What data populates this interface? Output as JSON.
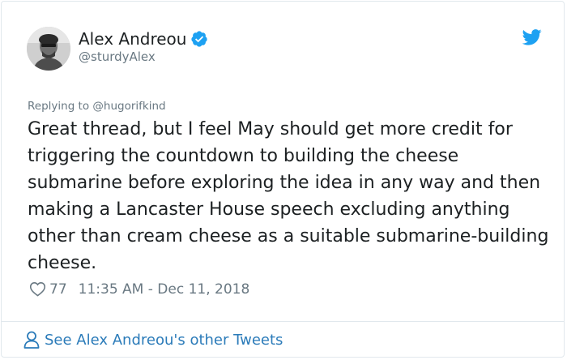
{
  "tweet": {
    "author": {
      "name": "Alex Andreou",
      "handle": "@sturdyAlex",
      "verified_icon": "verified-badge-icon",
      "avatar": "avatar-photo"
    },
    "brand_icon": "twitter-bird-icon",
    "replying_to": "Replying to @hugorifkind",
    "text": "Great thread, but I feel May should get more credit for triggering the countdown to building the cheese submarine before exploring the idea in any way and then making a Lancaster House speech excluding anything other than cream cheese as a suitable submarine-building cheese.",
    "likes": "77",
    "timestamp": "11:35 AM - Dec 11, 2018"
  },
  "footer": {
    "other_tweets_label": "See Alex Andreou's other Tweets",
    "icon": "person-icon"
  },
  "colors": {
    "link": "#2b7bb9",
    "muted": "#697882",
    "text": "#1c2022",
    "verified": "#1da1f2",
    "border": "#e1e8ed"
  }
}
